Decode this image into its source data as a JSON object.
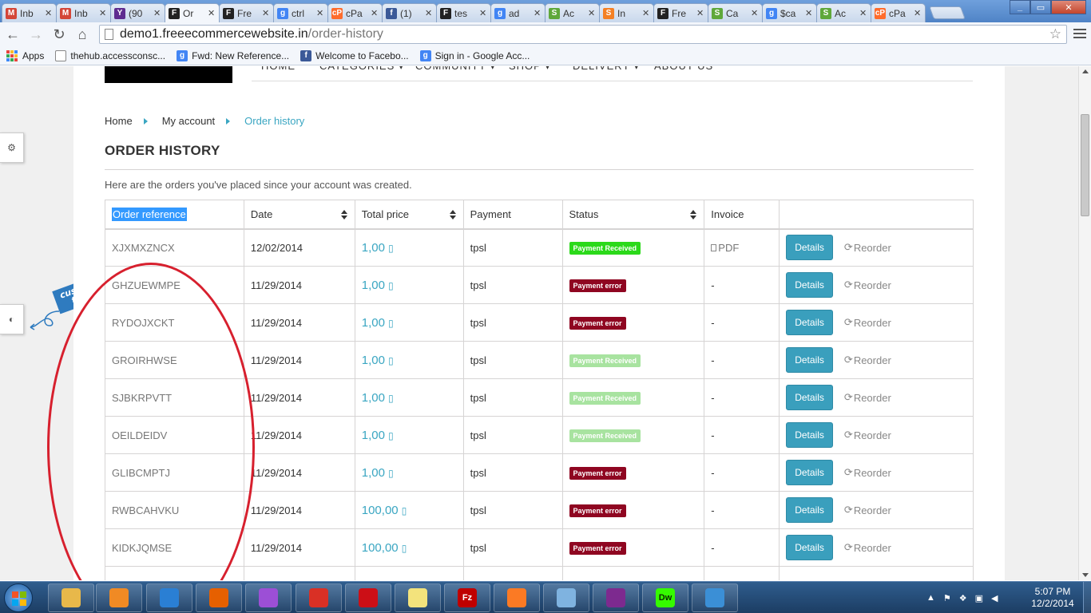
{
  "browser": {
    "tabs": [
      {
        "title": "Inb",
        "fav": "M",
        "color": "#d44638"
      },
      {
        "title": "Inb",
        "fav": "M",
        "color": "#d44638"
      },
      {
        "title": "(90",
        "fav": "Y",
        "color": "#5f2c90"
      },
      {
        "title": "Or",
        "fav": "F",
        "color": "#222222",
        "active": true
      },
      {
        "title": "Fre",
        "fav": "F",
        "color": "#222222"
      },
      {
        "title": "ctrl",
        "fav": "g",
        "color": "#4285f4"
      },
      {
        "title": "cPa",
        "fav": "cP",
        "color": "#ff6c2c"
      },
      {
        "title": "(1)",
        "fav": "f",
        "color": "#3b5998"
      },
      {
        "title": "tes",
        "fav": "F",
        "color": "#222222"
      },
      {
        "title": "ad",
        "fav": "g",
        "color": "#4285f4"
      },
      {
        "title": "Ac",
        "fav": "S",
        "color": "#5fa83a"
      },
      {
        "title": "In",
        "fav": "S",
        "color": "#f48024"
      },
      {
        "title": "Fre",
        "fav": "F",
        "color": "#222222"
      },
      {
        "title": "Ca",
        "fav": "S",
        "color": "#5fa83a"
      },
      {
        "title": "$ca",
        "fav": "g",
        "color": "#4285f4"
      },
      {
        "title": "Ac",
        "fav": "S",
        "color": "#5fa83a"
      },
      {
        "title": "cPa",
        "fav": "cP",
        "color": "#ff6c2c"
      }
    ],
    "close_glyph": "✕",
    "url_host": "demo1.freeecommercewebsite.in",
    "url_path": "/order-history",
    "bookmarks": [
      {
        "label": "Apps",
        "icon": "apps-icon"
      },
      {
        "label": "thehub.accessconsc...",
        "icon": "page-icon",
        "color": "#ffffff"
      },
      {
        "label": "Fwd: New Reference...",
        "icon": "google-icon",
        "fav": "g",
        "color": "#4285f4"
      },
      {
        "label": "Welcome to Facebo...",
        "icon": "facebook-icon",
        "fav": "f",
        "color": "#3b5998"
      },
      {
        "label": "Sign in - Google Acc...",
        "icon": "google-icon",
        "fav": "g",
        "color": "#4285f4"
      }
    ]
  },
  "site": {
    "nav": [
      "HOME",
      "CATEGORIES ▾",
      "COMMUNITY ▾",
      "SHOP ▾",
      "DELIVERY ▾",
      "ABOUT US"
    ],
    "breadcrumb": {
      "home": "Home",
      "account": "My account",
      "current": "Order history"
    },
    "heading": "ORDER HISTORY",
    "intro": "Here are the orders you've placed since your account was created.",
    "columns": {
      "reference": "Order reference",
      "date": "Date",
      "total": "Total price",
      "payment": "Payment",
      "status": "Status",
      "invoice": "Invoice"
    },
    "orders": [
      {
        "ref": "XJXMXZNCX",
        "date": "12/02/2014",
        "price": "1,00 ",
        "payment": "tpsl",
        "status": "Payment Received",
        "status_kind": "green",
        "invoice": "PDF"
      },
      {
        "ref": "GHZUEWMPE",
        "date": "11/29/2014",
        "price": "1,00 ",
        "payment": "tpsl",
        "status": "Payment error",
        "status_kind": "red",
        "invoice": "-"
      },
      {
        "ref": "RYDOJXCKT",
        "date": "11/29/2014",
        "price": "1,00 ",
        "payment": "tpsl",
        "status": "Payment error",
        "status_kind": "red",
        "invoice": "-"
      },
      {
        "ref": "GROIRHWSE",
        "date": "11/29/2014",
        "price": "1,00 ",
        "payment": "tpsl",
        "status": "Payment Received",
        "status_kind": "light",
        "invoice": "-"
      },
      {
        "ref": "SJBKRPVTT",
        "date": "11/29/2014",
        "price": "1,00 ",
        "payment": "tpsl",
        "status": "Payment Received",
        "status_kind": "light",
        "invoice": "-"
      },
      {
        "ref": "OEILDEIDV",
        "date": "11/29/2014",
        "price": "1,00 ",
        "payment": "tpsl",
        "status": "Payment Received",
        "status_kind": "light",
        "invoice": "-"
      },
      {
        "ref": "GLIBCMPTJ",
        "date": "11/29/2014",
        "price": "1,00 ",
        "payment": "tpsl",
        "status": "Payment error",
        "status_kind": "red",
        "invoice": "-"
      },
      {
        "ref": "RWBCAHVKU",
        "date": "11/29/2014",
        "price": "100,00 ",
        "payment": "tpsl",
        "status": "Payment error",
        "status_kind": "red",
        "invoice": "-"
      },
      {
        "ref": "KIDKJQMSE",
        "date": "11/29/2014",
        "price": "100,00 ",
        "payment": "tpsl",
        "status": "Payment error",
        "status_kind": "red",
        "invoice": "-"
      }
    ],
    "details_label": "Details",
    "reorder_label": "Reorder",
    "reorder_glyph": "⟳",
    "currency_glyph": "▯",
    "customize_ribbon": "customize theme",
    "side_tab_1_glyph": "⚙",
    "side_tab_2_glyph": "◐"
  },
  "status_colors": {
    "green": "#2bd91a",
    "red": "#8f0621",
    "light": "#a8e3a0"
  },
  "taskbar": {
    "apps": [
      {
        "name": "explorer-icon",
        "color": "#e8b84a"
      },
      {
        "name": "media-player-icon",
        "color": "#f08a24"
      },
      {
        "name": "internet-explorer-icon",
        "color": "#2a7fd4"
      },
      {
        "name": "firefox-icon",
        "color": "#e66000"
      },
      {
        "name": "picasa-icon",
        "color": "#9c4fd6"
      },
      {
        "name": "chrome-icon",
        "color": "#d93025"
      },
      {
        "name": "opera-icon",
        "color": "#cc0f16"
      },
      {
        "name": "sticky-notes-icon",
        "color": "#f3e37c"
      },
      {
        "name": "filezilla-icon",
        "color": "#bf0000",
        "label": "Fz"
      },
      {
        "name": "xampp-icon",
        "color": "#fb7a24"
      },
      {
        "name": "notepad-icon",
        "color": "#7fb3e0"
      },
      {
        "name": "winrar-icon",
        "color": "#7d2a8f"
      },
      {
        "name": "dreamweaver-icon",
        "color": "#35fa00",
        "label": "Dw"
      },
      {
        "name": "safari-icon",
        "color": "#3b8fd6"
      }
    ],
    "time": "5:07 PM",
    "date": "12/2/2014"
  }
}
